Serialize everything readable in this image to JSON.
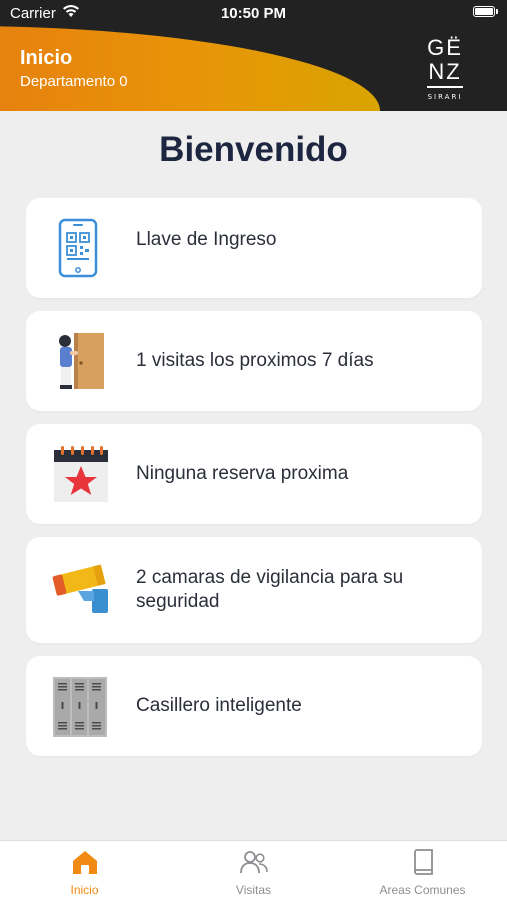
{
  "status_bar": {
    "carrier": "Carrier",
    "time": "10:50 PM"
  },
  "header": {
    "title": "Inicio",
    "subtitle": "Departamento 0",
    "logo": {
      "line1": "GË",
      "line2": "NZ",
      "tagline": "SIRARI"
    }
  },
  "page": {
    "title": "Bienvenido"
  },
  "cards": [
    {
      "label": "Llave de Ingreso",
      "icon": "phone-qr-icon"
    },
    {
      "label": "1 visitas los proximos 7 días",
      "icon": "visitor-door-icon"
    },
    {
      "label": "Ninguna reserva proxima",
      "icon": "calendar-star-icon"
    },
    {
      "label": "2 camaras de vigilancia para su seguridad",
      "icon": "security-camera-icon"
    },
    {
      "label": "Casillero inteligente",
      "icon": "lockers-icon"
    }
  ],
  "tabbar": {
    "tabs": [
      {
        "label": "Inicio",
        "icon": "home-icon",
        "active": true
      },
      {
        "label": "Visitas",
        "icon": "people-icon",
        "active": false
      },
      {
        "label": "Areas Comunes",
        "icon": "book-icon",
        "active": false
      }
    ]
  },
  "colors": {
    "accent": "#f08a12",
    "header_dark": "#222222",
    "title": "#1d2640",
    "background": "#eeeeee"
  }
}
